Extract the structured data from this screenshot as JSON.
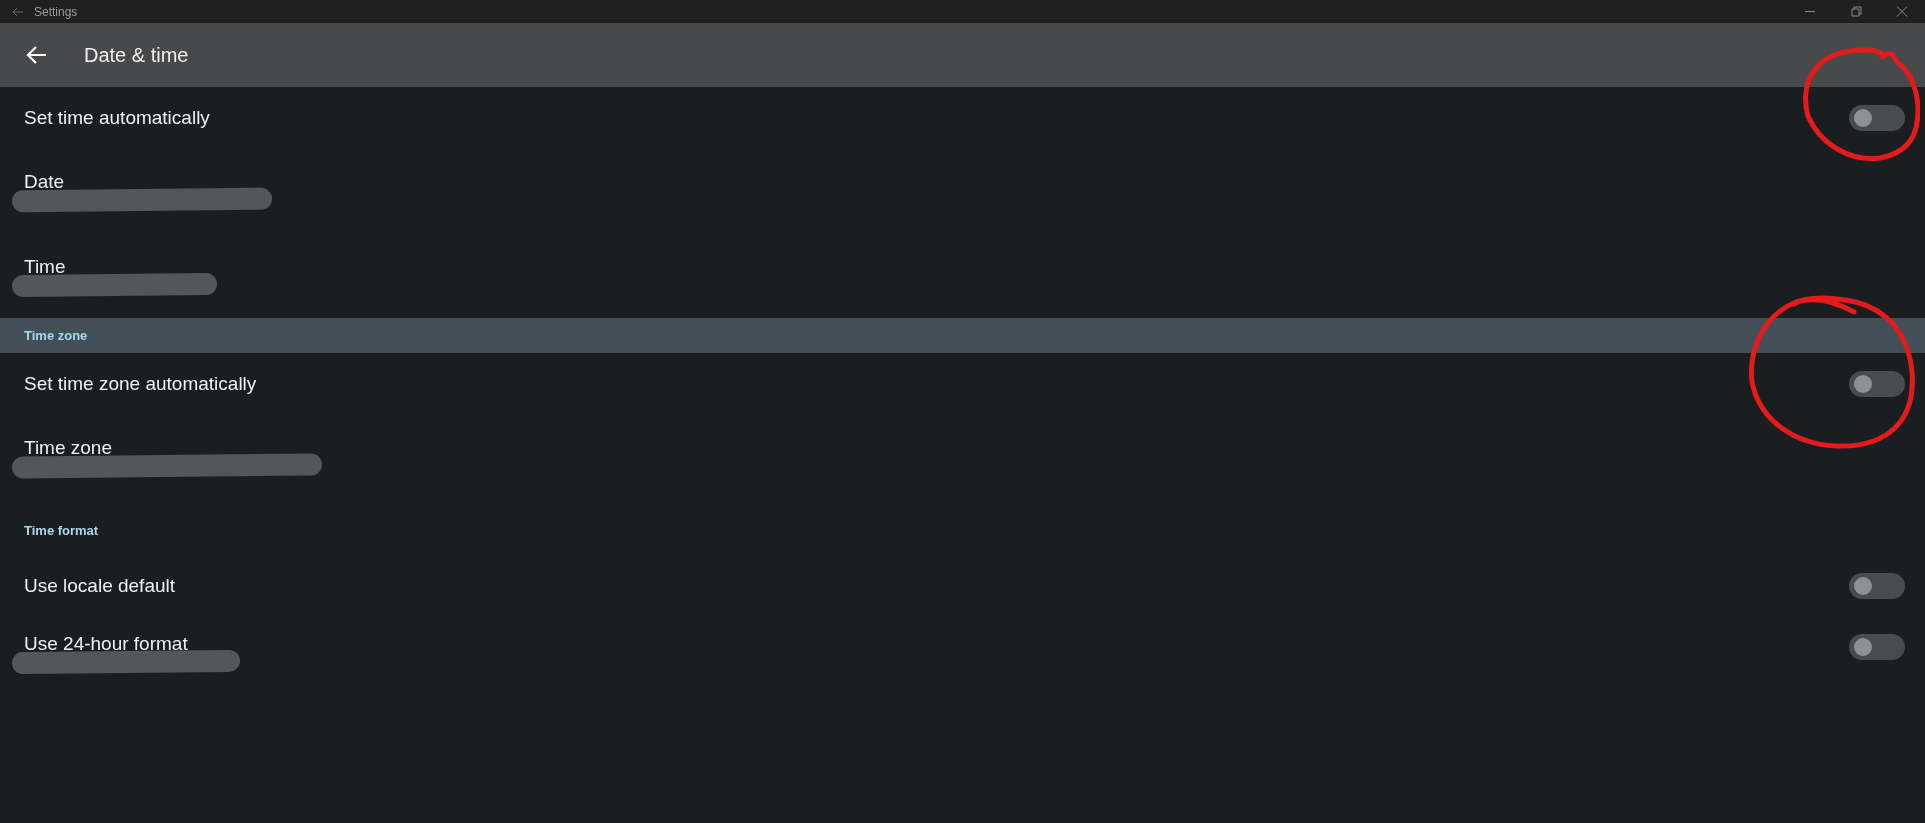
{
  "window": {
    "title": "Settings"
  },
  "header": {
    "title": "Date & time"
  },
  "items": [
    {
      "kind": "switch",
      "label": "Set time automatically",
      "checked": false,
      "redacted": false
    },
    {
      "kind": "value",
      "label": "Date",
      "redacted": true
    },
    {
      "kind": "value",
      "label": "Time",
      "redacted": true
    },
    {
      "kind": "band",
      "label": "Time zone"
    },
    {
      "kind": "switch",
      "label": "Set time zone automatically",
      "checked": false,
      "redacted": false
    },
    {
      "kind": "value",
      "label": "Time zone",
      "redacted": true
    },
    {
      "kind": "section",
      "label": "Time format"
    },
    {
      "kind": "switch",
      "label": "Use locale default",
      "checked": false,
      "redacted": false
    },
    {
      "kind": "switch",
      "label": "Use 24-hour format",
      "checked": false,
      "redacted": true
    }
  ]
}
